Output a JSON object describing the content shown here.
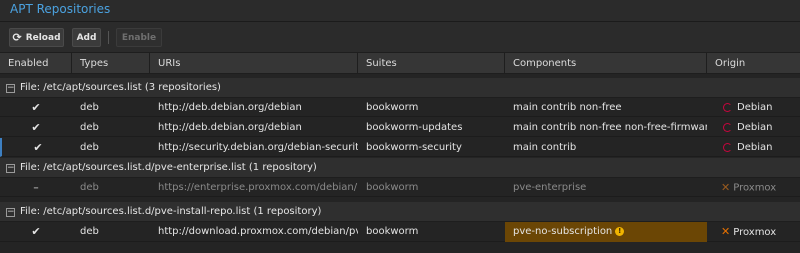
{
  "panel": {
    "title": "APT Repositories"
  },
  "toolbar": {
    "reload_label": "Reload",
    "reload_icon": "reload-icon",
    "add_label": "Add",
    "enable_label": "Enable"
  },
  "columns": [
    "Enabled",
    "Types",
    "URIs",
    "Suites",
    "Components",
    "Origin"
  ],
  "groups": [
    {
      "label": "File: /etc/apt/sources.list (3 repositories)",
      "rows": [
        {
          "enabled": "✔",
          "type": "deb",
          "uri": "http://deb.debian.org/debian",
          "suite": "bookworm",
          "components": "main contrib non-free",
          "origin": "Debian",
          "origin_icon": "debian-icon"
        },
        {
          "enabled": "✔",
          "type": "deb",
          "uri": "http://deb.debian.org/debian",
          "suite": "bookworm-updates",
          "components": "main contrib non-free non-free-firmware",
          "origin": "Debian",
          "origin_icon": "debian-icon"
        },
        {
          "enabled": "✔",
          "type": "deb",
          "uri": "http://security.debian.org/debian-security",
          "suite": "bookworm-security",
          "components": "main contrib",
          "origin": "Debian",
          "origin_icon": "debian-icon"
        }
      ]
    },
    {
      "label": "File: /etc/apt/sources.list.d/pve-enterprise.list (1 repository)",
      "rows": [
        {
          "enabled": "–",
          "type": "deb",
          "uri": "https://enterprise.proxmox.com/debian/pve",
          "suite": "bookworm",
          "components": "pve-enterprise",
          "origin": "Proxmox",
          "origin_icon": "proxmox-icon"
        }
      ]
    },
    {
      "label": "File: /etc/apt/sources.list.d/pve-install-repo.list (1 repository)",
      "rows": [
        {
          "enabled": "✔",
          "type": "deb",
          "uri": "http://download.proxmox.com/debian/pve",
          "suite": "bookworm",
          "components": "pve-no-subscription",
          "origin": "Proxmox",
          "origin_icon": "proxmox-icon",
          "warning": "!"
        }
      ]
    }
  ],
  "colors": {
    "title": "#4ba2e0",
    "warning_bg": "#6b4605",
    "warning_icon": "#f0b400",
    "proxmox": "#e57000",
    "debian": "#c7053d"
  }
}
